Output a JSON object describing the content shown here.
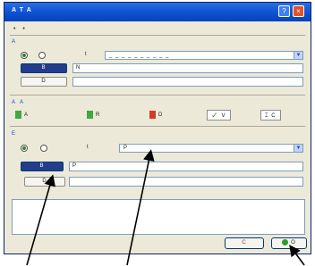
{
  "window": {
    "title": "A  T  A",
    "help_glyph": "?",
    "close_glyph": "×"
  },
  "top_section": {
    "dots": "• •",
    "header": "A",
    "field_label": "t",
    "combo_value": "_ _ _ _ _ _ _ _ _ _",
    "button1_label": "B",
    "field1_value": "N",
    "button2_label": "D"
  },
  "toolbar": {
    "header": "A  A",
    "items": [
      {
        "label": "A",
        "icon": "green-square-icon"
      },
      {
        "label": "R",
        "icon": "green-square-icon"
      },
      {
        "label": "D",
        "icon": "red-square-icon"
      },
      {
        "label": "V",
        "icon": "checkmark-icon"
      },
      {
        "label": "C",
        "icon": "cursor-icon"
      }
    ]
  },
  "bottom_section": {
    "header": "E",
    "field_label": "t",
    "combo_value": "P",
    "button1_label": "B",
    "field1_value": "P",
    "button2_label": "D"
  },
  "dialog_buttons": {
    "cancel_label": "C",
    "ok_label": "O"
  },
  "colors": {
    "titlebar": "#0a4fd0",
    "window_bg": "#ece9d8",
    "highlight": "#243c8c",
    "ok_green": "#2e9a2e"
  }
}
